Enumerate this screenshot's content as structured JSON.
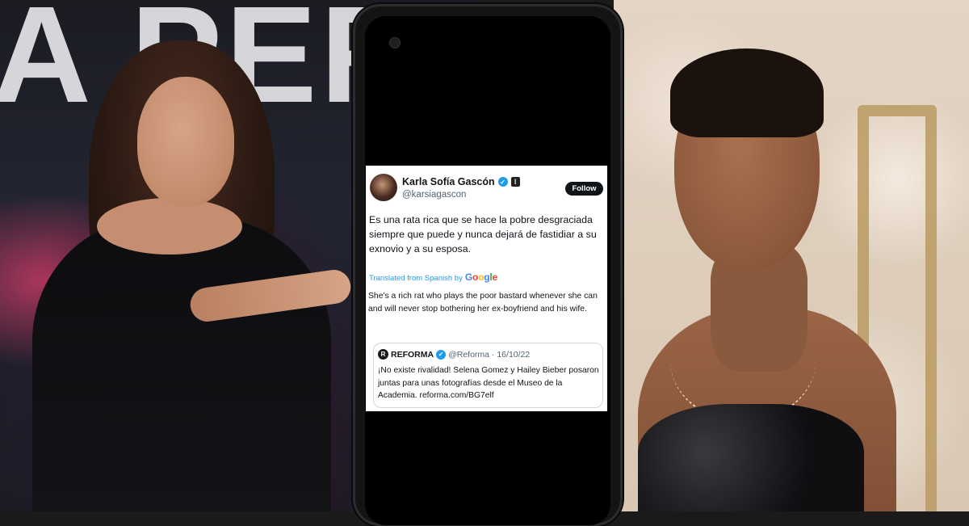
{
  "background": {
    "left_sign_text": "A PERI"
  },
  "tweet": {
    "author_name": "Karla Sofía Gascón",
    "handle": "@karsiagascon",
    "follow_label": "Follow",
    "text": "Es una rata rica que se hace la pobre desgraciada siempre que puede y nunca dejará de fastidiar a su exnovio y a su esposa.",
    "translated_from": "Translated from Spanish by",
    "translator_letters": [
      "G",
      "o",
      "o",
      "g",
      "l",
      "e"
    ],
    "translation": "She's a rich rat who plays the poor bastard whenever she can and will never stop bothering her ex-boyfriend and his wife.",
    "quote": {
      "logo_letter": "R",
      "name": "REFORMA",
      "meta": "@Reforma · 16/10/22",
      "text": "¡No existe rivalidad! Selena Gomez y Hailey Bieber posaron juntas para unas fotografías desde el Museo de la Academia.  reforma.com/BG7elf"
    }
  },
  "colors": {
    "verified_blue": "#1d9bf0",
    "follow_button_bg": "#0f1419",
    "secondary_text": "#536471"
  },
  "icons": {
    "verified": "verified-badge-icon",
    "affiliate": "affiliate-badge-icon",
    "reforma": "reforma-logo-icon"
  }
}
